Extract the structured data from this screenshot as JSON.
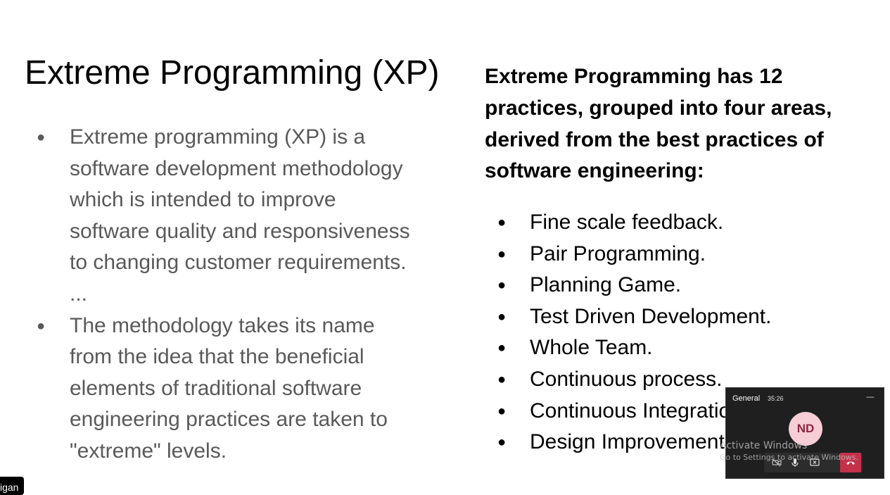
{
  "slide": {
    "title": "Extreme Programming (XP)",
    "left_bullets": [
      "Extreme programming (XP) is a software development methodology which is intended to improve software quality and responsiveness to changing customer requirements. ...",
      "The methodology takes its name from the idea that the beneficial elements of traditional software engineering practices are taken to \"extreme\" levels."
    ],
    "right_heading": "Extreme Programming has 12 practices, grouped into four areas, derived from the best practices of software engineering:",
    "practices": [
      "Fine scale feedback.",
      "Pair Programming.",
      "Planning Game.",
      "Test Driven Development.",
      "Whole Team.",
      "Continuous process.",
      "Continuous Integration.",
      "Design Improvement."
    ],
    "bullet_char": "●"
  },
  "call_window": {
    "channel": "General",
    "timer": "35:26",
    "minimize_label": "—",
    "avatar_initials": "ND",
    "controls": [
      "video-off-icon",
      "microphone-icon",
      "stop-share-icon",
      "hang-up-icon"
    ]
  },
  "watermark": {
    "title": "Activate Windows",
    "subtitle": "Go to Settings to activate Windows."
  },
  "presenter_tag": {
    "text": "igan"
  },
  "colors": {
    "body_text": "#595959",
    "call_bg": "#1f1f1f",
    "hangup": "#c4314b",
    "avatar_bg": "#f7cdd6",
    "avatar_text": "#8e2440"
  }
}
